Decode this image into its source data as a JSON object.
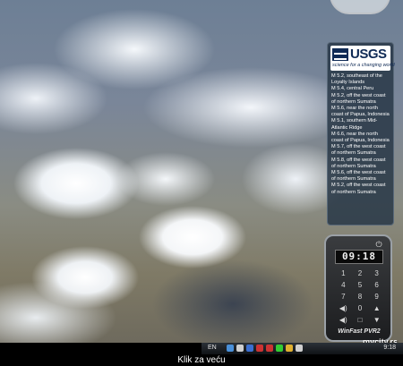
{
  "usgs": {
    "logo_text": "USGS",
    "tagline": "science for a changing world",
    "quakes": [
      "M 5.2, southeast of the Loyalty Islands",
      "M 5.4, central Peru",
      "M 5.2, off the west coast of northern Sumatra",
      "M 5.6, near the north coast of Papua, Indonesia",
      "M 5.1, southern Mid-Atlantic Ridge",
      "M 6.6, near the north coast of Papua, Indonesia",
      "M 5.7, off the west coast of northern Sumatra",
      "M 5.8, off the west coast of northern Sumatra",
      "M 5.6, off the west coast of northern Sumatra",
      "M 5.2, off the west coast of northern Sumatra"
    ]
  },
  "remote": {
    "time": "09:18",
    "power_icon": "power-icon",
    "keys": [
      "1",
      "2",
      "3",
      "4",
      "5",
      "6",
      "7",
      "8",
      "9",
      "◀)",
      "0",
      "▲",
      "◀)",
      "□",
      "▼"
    ],
    "brand": "WinFast PVR2"
  },
  "taskbar": {
    "language": "EN",
    "clock": "9:18",
    "tray_colors": [
      "#4a90d9",
      "#cfcfcf",
      "#3b6fd0",
      "#c33",
      "#c33",
      "#3c3",
      "#e0b030",
      "#cfcfcf"
    ]
  },
  "watermark": "mycity.rs",
  "caption": "Klik za veću"
}
